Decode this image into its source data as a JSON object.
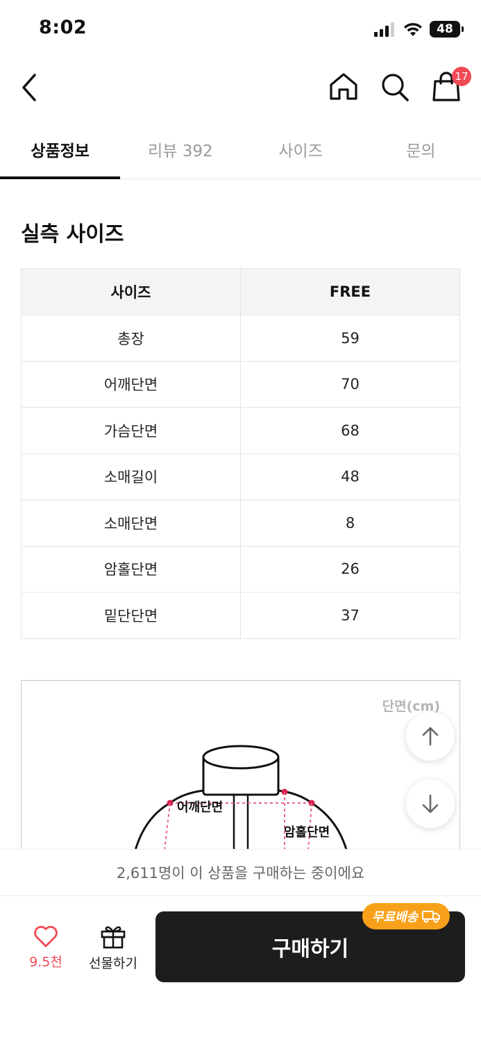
{
  "status_bar": {
    "time": "8:02",
    "battery": "48"
  },
  "nav": {
    "cart_count": "17"
  },
  "tabs": [
    {
      "label": "상품정보"
    },
    {
      "label": "리뷰 392"
    },
    {
      "label": "사이즈"
    },
    {
      "label": "문의"
    }
  ],
  "section": {
    "title": "실측 사이즈"
  },
  "size_table": {
    "headers": [
      "사이즈",
      "FREE"
    ],
    "rows": [
      {
        "name": "총장",
        "value": "59"
      },
      {
        "name": "어깨단면",
        "value": "70"
      },
      {
        "name": "가슴단면",
        "value": "68"
      },
      {
        "name": "소매길이",
        "value": "48"
      },
      {
        "name": "소매단면",
        "value": "8"
      },
      {
        "name": "암홀단면",
        "value": "26"
      },
      {
        "name": "밑단단면",
        "value": "37"
      }
    ]
  },
  "diagram": {
    "unit": "단면(cm)",
    "label_shoulder": "어깨단면",
    "label_armhole": "암홀단면"
  },
  "buyers_text": "2,611명이 이 상품을 구매하는 중이에요",
  "bottom": {
    "like_count": "9.5천",
    "gift_label": "선물하기",
    "buy_label": "구매하기",
    "free_shipping": "무료배송"
  },
  "colors": {
    "accent_red": "#ef4a56",
    "free_ship_orange": "#f7a11a",
    "buy_button": "#1d1d1d"
  }
}
